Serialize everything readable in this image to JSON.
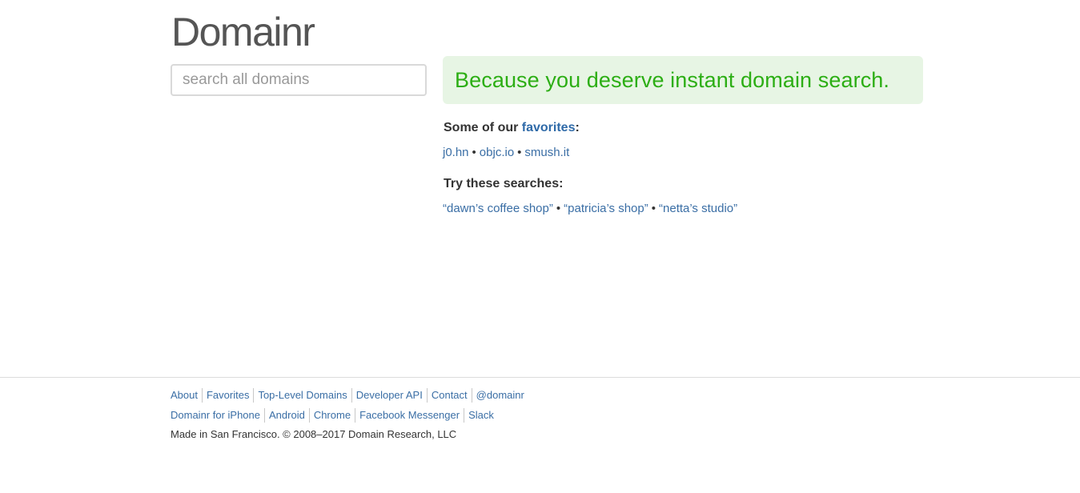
{
  "header": {
    "logo": "Domainr"
  },
  "search": {
    "placeholder": "search all domains",
    "value": ""
  },
  "tagline": "Because you deserve instant domain search.",
  "favorites": {
    "heading_prefix": "Some of our ",
    "heading_link": "favorites",
    "heading_suffix": ":",
    "items": [
      "j0.hn",
      "objc.io",
      "smush.it"
    ]
  },
  "searches": {
    "heading": "Try these searches:",
    "items": [
      "“dawn’s coffee shop”",
      "“patricia’s shop”",
      "“netta’s studio”"
    ]
  },
  "separator": "•",
  "footer": {
    "row1": [
      "About",
      "Favorites",
      "Top-Level Domains",
      "Developer API",
      "Contact",
      "@domainr"
    ],
    "row2": [
      "Domainr for iPhone",
      "Android",
      "Chrome",
      "Facebook Messenger",
      "Slack"
    ],
    "copyright": "Made in San Francisco. © 2008–2017 Domain Research, LLC"
  },
  "colors": {
    "link": "#3a6ea5",
    "tagline_text": "#2cae14",
    "tagline_bg": "#e7f5e4"
  }
}
